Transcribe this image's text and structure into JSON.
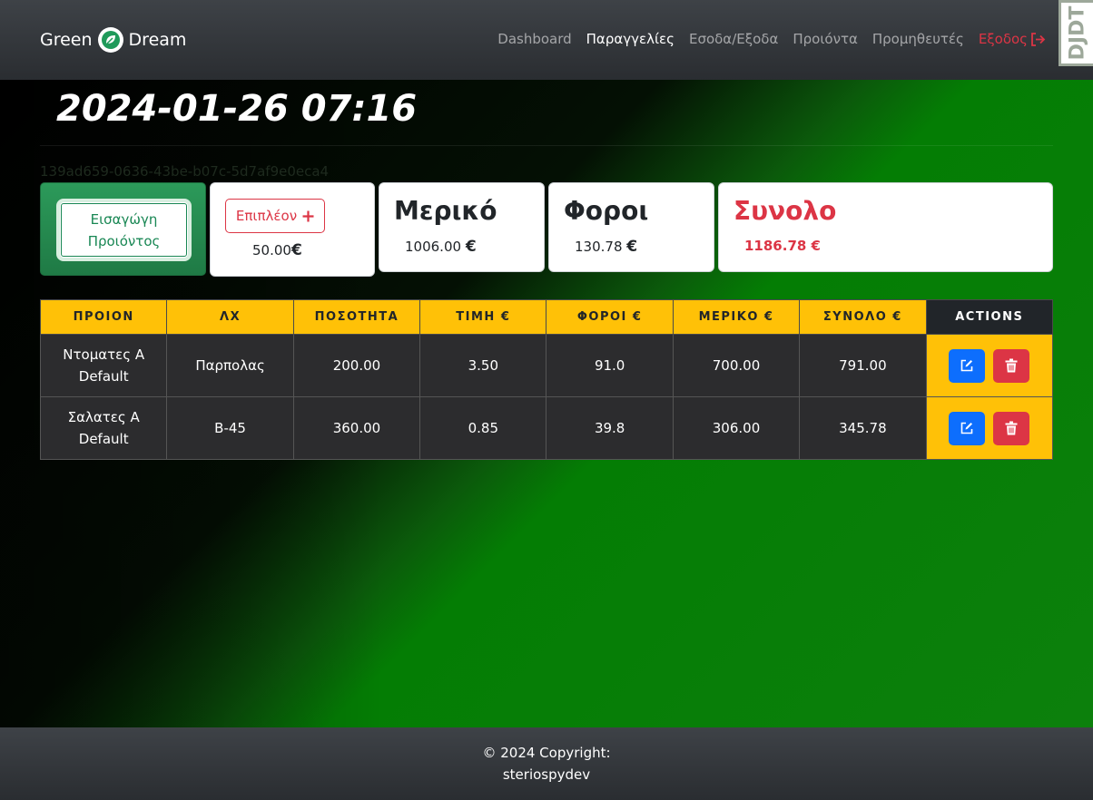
{
  "navbar": {
    "brand_left": "Green",
    "brand_right": "Dream",
    "logo_icon": "leaf-icon",
    "links": [
      {
        "label": "Dashboard",
        "active": false
      },
      {
        "label": "Παραγγελίες",
        "active": true
      },
      {
        "label": "Εσοδα/Εξοδα",
        "active": false
      },
      {
        "label": "Προιόντα",
        "active": false
      },
      {
        "label": "Προμηθευτές",
        "active": false
      }
    ],
    "logout_label": "Εξοδος",
    "logout_icon": "sign-out-icon",
    "djdt_label": "DJDT"
  },
  "order": {
    "datetime": "2024-01-26 07:16",
    "uuid": "139ad659-0636-43be-b07c-5d7af9e0eca4"
  },
  "cards": {
    "insert_product_label": "Εισαγώγη Προιόντος",
    "extra_button_label": "Επιπλέον",
    "extra_icon": "plus-icon",
    "extra_value": "50.00",
    "currency": "€",
    "merikos_title": "Μερικό",
    "merikos_value": "1006.00",
    "foroi_title": "Φοροι",
    "foroi_value": "130.78",
    "synolo_title": "Συνολο",
    "synolo_value": "1186.78 €"
  },
  "table": {
    "headers": [
      "ΠΡΟΙΟΝ",
      "ΛΧ",
      "ΠΟΣΟΤΗΤΑ",
      "ΤΙΜΗ €",
      "ΦΟΡΟΙ €",
      "ΜΕΡΙΚΟ €",
      "ΣΥΝΟΛΟ €",
      "ACTIONS"
    ],
    "rows": [
      {
        "product": "Ντοματες Α Default",
        "lx": "Παρπολας",
        "quantity": "200.00",
        "price": "3.50",
        "taxes": "91.0",
        "partial": "700.00",
        "total": "791.00"
      },
      {
        "product": "Σαλατες Α Default",
        "lx": "B-45",
        "quantity": "360.00",
        "price": "0.85",
        "taxes": "39.8",
        "partial": "306.00",
        "total": "345.78"
      }
    ]
  },
  "footer": {
    "copyright": "© 2024 Copyright:",
    "author": "steriospydev"
  },
  "colors": {
    "accent_green": "#198754",
    "danger": "#dc3545",
    "primary": "#0d6efd",
    "warning": "#ffc107"
  }
}
